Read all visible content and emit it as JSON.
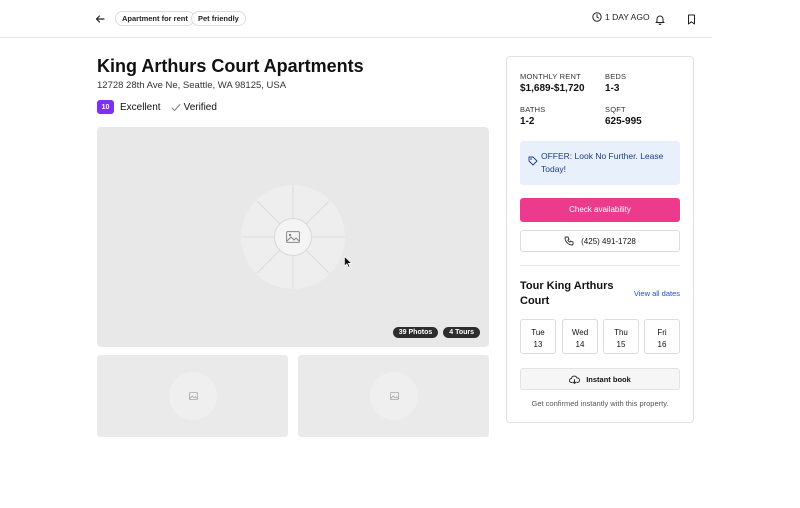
{
  "header": {
    "chips": [
      "Apartment for rent",
      "Pet friendly"
    ],
    "time": "1 DAY AGO"
  },
  "listing": {
    "title": "King Arthurs Court Apartments",
    "address": "12728 28th Ave Ne, Seattle, WA 98125, USA",
    "score": "10",
    "rating_text": "Excellent",
    "verified": "Verified"
  },
  "photos": {
    "photos_badge": "39 Photos",
    "tours_badge": "4 Tours"
  },
  "sidebar": {
    "rent_label": "MONTHLY RENT",
    "rent_value": "$1,689-$1,720",
    "beds_label": "BEDS",
    "beds_value": "1-3",
    "baths_label": "BATHS",
    "baths_value": "1-2",
    "sqft_label": "SQFT",
    "sqft_value": "625-995",
    "offer": "OFFER: Look No Further. Lease Today!",
    "cta": "Check availability",
    "phone": "(425) 491-1728",
    "tour_title": "Tour King Arthurs Court",
    "view_all": "View all dates",
    "days": [
      {
        "dow": "Tue",
        "date": "13"
      },
      {
        "dow": "Wed",
        "date": "14"
      },
      {
        "dow": "Thu",
        "date": "15"
      },
      {
        "dow": "Fri",
        "date": "16"
      }
    ],
    "instant_book": "Instant book",
    "confirm_text": "Get confirmed instantly with this property."
  },
  "colors": {
    "accent": "#ec3b8c",
    "score_badge": "#7b2ff7",
    "offer_bg": "#e8f0fb",
    "link": "#1f4fd1"
  }
}
